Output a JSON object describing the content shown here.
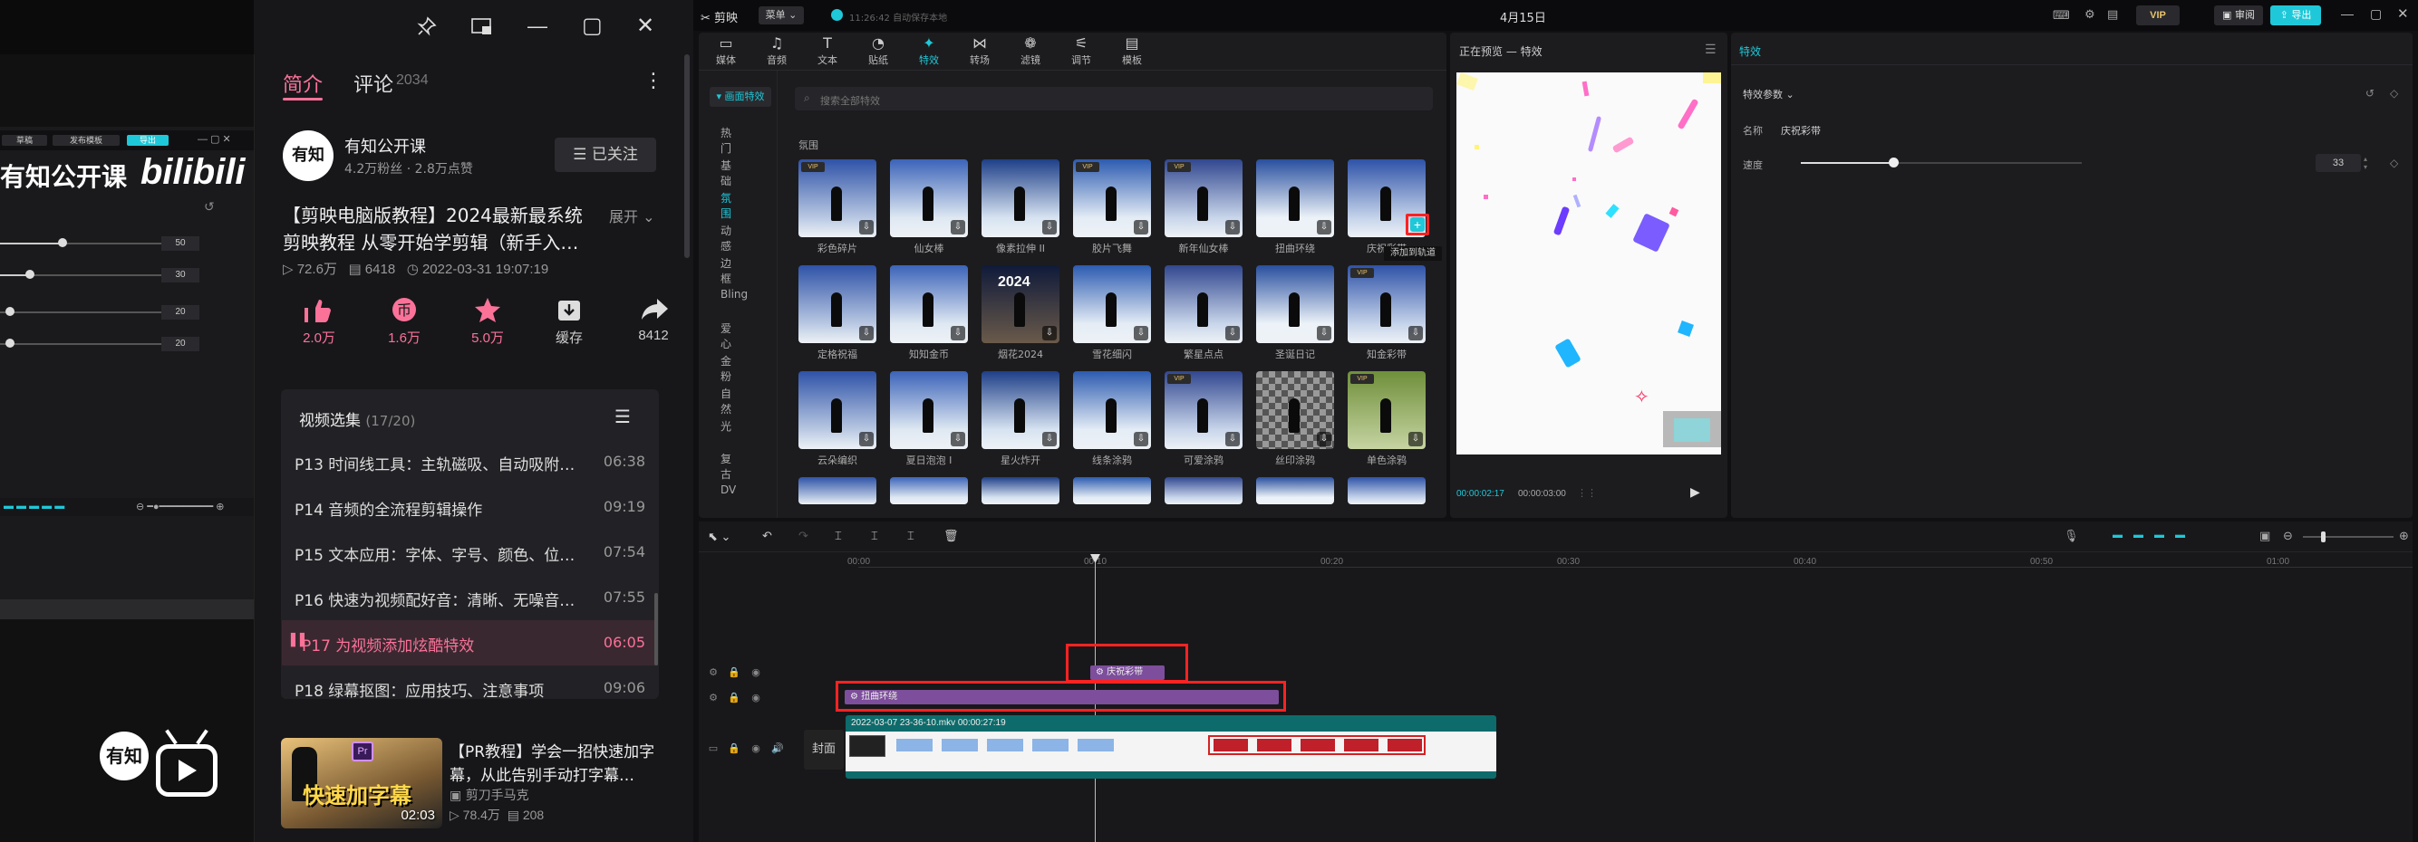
{
  "left_video": {
    "editor_title": "有知公开课",
    "brand": "bilibili",
    "mini_buttons": [
      "草稿",
      "发布模板",
      "导出"
    ],
    "slider_values": [
      "50",
      "30",
      "20",
      "20"
    ],
    "watermark": "有知"
  },
  "window_controls": {
    "pin": "pin-icon",
    "pip": "pip-icon",
    "minimize": "—",
    "maximize": "▢",
    "close": "✕"
  },
  "bili": {
    "tab_intro": "简介",
    "tab_comments": "评论",
    "comment_count": "2034",
    "uploader": {
      "name": "有知公开课",
      "avatar_text": "有知",
      "stats": "4.2万粉丝 · 2.8万点赞",
      "follow_label": "☰ 已关注"
    },
    "video": {
      "title_line1": "【剪映电脑版教程】2024最新最系统",
      "title_line2": "剪映教程 从零开始学剪辑（新手入…",
      "expand": "展开",
      "plays": "72.6万",
      "danmaku": "6418",
      "date": "2022-03-31 19:07:19"
    },
    "actions": [
      {
        "icon": "like-icon",
        "label": "2.0万"
      },
      {
        "icon": "coin-icon",
        "label": "1.6万"
      },
      {
        "icon": "star-icon",
        "label": "5.0万"
      },
      {
        "icon": "cache-icon",
        "label": "缓存"
      },
      {
        "icon": "share-icon",
        "label": "8412"
      }
    ],
    "playlist_title": "视频选集",
    "playlist_count": "(17/20)",
    "episodes": [
      {
        "title": "P13  时间线工具：主轨磁吸、自动吸附…",
        "duration": "06:38"
      },
      {
        "title": "P14  音频的全流程剪辑操作",
        "duration": "09:19"
      },
      {
        "title": "P15  文本应用：字体、字号、颜色、位…",
        "duration": "07:54"
      },
      {
        "title": "P16  快速为视频配好音：清晰、无噪音…",
        "duration": "07:55"
      },
      {
        "title": "P17  为视频添加炫酷特效",
        "duration": "06:05"
      },
      {
        "title": "P18  绿幕抠图：应用技巧、注意事项",
        "duration": "09:06"
      }
    ],
    "recommended": {
      "title_line1": "【PR教程】学会一招快速加字",
      "title_line2": "幕，从此告别手动打字幕…",
      "thumb_text": "快速加字幕",
      "duration": "02:03",
      "author": "剪刀手马克",
      "plays": "78.4万",
      "danmaku": "208"
    }
  },
  "capcut": {
    "app_name": "剪映",
    "menu_label": "菜单",
    "autosave": "11:26:42 自动保存本地",
    "doc_title": "4月15日",
    "vip": "VIP",
    "review": "审阅",
    "export": "导出",
    "toolbar": [
      {
        "icon": "media-icon",
        "label": "媒体"
      },
      {
        "icon": "audio-icon",
        "label": "音频"
      },
      {
        "icon": "text-icon",
        "label": "文本"
      },
      {
        "icon": "sticker-icon",
        "label": "贴纸"
      },
      {
        "icon": "effects-icon",
        "label": "特效"
      },
      {
        "icon": "transition-icon",
        "label": "转场"
      },
      {
        "icon": "filter-icon",
        "label": "滤镜"
      },
      {
        "icon": "adjust-icon",
        "label": "调节"
      },
      {
        "icon": "template-icon",
        "label": "模板"
      }
    ],
    "active_tool": 4,
    "categories": [
      "画面特效",
      "热门",
      "基础",
      "氛围",
      "动感",
      "边框",
      "Bling",
      "爱心",
      "金粉",
      "自然",
      "光",
      "复古",
      "DV"
    ],
    "active_category": 3,
    "search_placeholder": "搜索全部特效",
    "section_label": "氛围",
    "effects": [
      "彩色碎片",
      "仙女棒",
      "像素拉伸 II",
      "胶片飞舞",
      "新年仙女棒",
      "扭曲环绕",
      "庆祝彩带",
      "定格祝福",
      "知知金币",
      "烟花2024",
      "雪花细闪",
      "繁星点点",
      "圣诞日记",
      "知金彩带",
      "云朵编织",
      "夏日泡泡 I",
      "星火炸开",
      "线条涂鸦",
      "可爱涂鸦",
      "丝印涂鸦",
      "单色涂鸦",
      "",
      "",
      "",
      "",
      "",
      "",
      ""
    ],
    "effect_2024_text": "2024",
    "add_tooltip": "添加到轨道",
    "preview": {
      "title": "正在预览 — 特效",
      "current": "00:00:02:17",
      "total": "00:00:03:00"
    },
    "props": {
      "panel_title": "特效",
      "section": "特效参数",
      "name_label": "名称",
      "name_value": "庆祝彩带",
      "speed_label": "速度",
      "speed_value": "33",
      "speed_fraction": 0.33
    },
    "timeline": {
      "ruler": [
        "00:00",
        "00:10",
        "00:20",
        "00:30",
        "00:40",
        "00:50",
        "01:00"
      ],
      "effect_clip": "庆祝彩带",
      "effect_clip2": "扭曲环绕",
      "video_clip": "2022-03-07 23-36-10.mkv  00:00:27:19",
      "cover_label": "封面"
    },
    "colors": {
      "accent": "#1fc8d8",
      "clip_effect": "#7d4e9b",
      "clip_video": "#0e6b6b",
      "highlight": "#ff2222",
      "bili_pink": "#fb7299"
    }
  }
}
